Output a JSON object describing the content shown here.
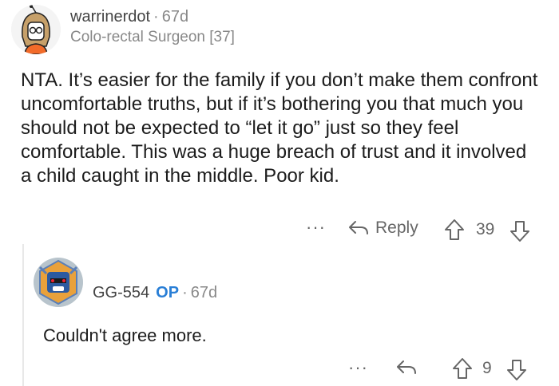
{
  "comment": {
    "username": "warrinerdot",
    "separator": "·",
    "age": "67d",
    "flair": "Colo-rectal Surgeon [37]",
    "body": "NTA. It’s easier for the family if you don’t make them confront uncomfortable truths, but if it’s bothering you that much you should not be expected to “let it go” just so they feel comfortable. This was a huge breach of trust and it involved a child caught in the middle. Poor kid.",
    "more_label": "···",
    "reply_label": "Reply",
    "score": "39"
  },
  "reply": {
    "username": "GG-554",
    "op_badge": "OP",
    "separator": "·",
    "age": "67d",
    "body": "Couldn't agree more.",
    "more_label": "···",
    "score": "9"
  },
  "icons": {
    "reply": "reply-arrow-icon",
    "upvote": "upvote-arrow-icon",
    "downvote": "downvote-arrow-icon"
  },
  "colors": {
    "op_badge": "#2a7fd6",
    "meta_text": "#888888",
    "action_text": "#666666"
  }
}
